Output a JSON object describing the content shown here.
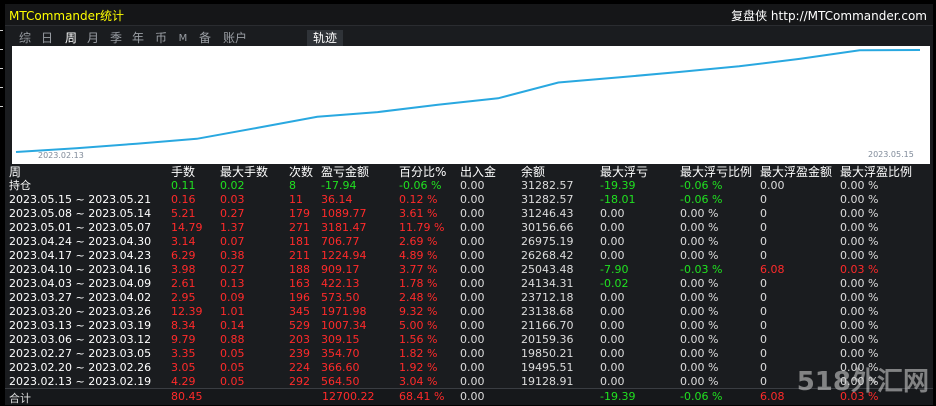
{
  "window": {
    "title": "MTCommander统计",
    "brand": "复盘侠",
    "url": "http://MTCommander.com"
  },
  "tabs": [
    {
      "label": "综"
    },
    {
      "label": "日"
    },
    {
      "label": "周",
      "active": true
    },
    {
      "label": "月"
    },
    {
      "label": "季"
    },
    {
      "label": "年"
    },
    {
      "label": "币"
    },
    {
      "label": "M"
    },
    {
      "label": "备"
    },
    {
      "label": "账户"
    },
    {
      "label": "轨迹",
      "active": true
    }
  ],
  "chart_data": {
    "type": "line",
    "x_labels": [
      "2023.02.13",
      "2023.05.15"
    ],
    "series": [
      {
        "color": "#29a8e0",
        "values": [
          0,
          4.29,
          9.34,
          14.79,
          26.94,
          39.37,
          44.59,
          52.87,
          60.12,
          77.8,
          83.45,
          89.51,
          95.86,
          104.16,
          113.71,
          114.1
        ]
      }
    ]
  },
  "table": {
    "headers": [
      "周",
      "手数",
      "最大手数",
      "次数",
      "盈亏金额",
      "百分比%",
      "出入金",
      "余额",
      "最大浮亏",
      "最大浮亏比例",
      "最大浮盈金额",
      "最大浮盈比例"
    ],
    "rows": [
      {
        "cls": "pos",
        "week": "持仓",
        "lots": "0.11",
        "maxlots": "0.02",
        "count": "8",
        "pnl": "-17.94",
        "pct": "-0.06 %",
        "io": "0.00",
        "bal": "31282.57",
        "maxdd": "-19.39",
        "maxddpct": "-0.06 %",
        "maxfp": "0.00",
        "maxfppct": "0.00 %"
      },
      {
        "cls": "red",
        "week": "2023.05.15 ~ 2023.05.21",
        "lots": "0.16",
        "maxlots": "0.03",
        "count": "11",
        "pnl": "36.14",
        "pct": "0.12 %",
        "io": "0.00",
        "bal": "31282.57",
        "maxdd": "-18.01",
        "maxddpct": "-0.06 %",
        "maxfp": "0",
        "maxfppct": "0.00 %"
      },
      {
        "cls": "red",
        "week": "2023.05.08 ~ 2023.05.14",
        "lots": "5.21",
        "maxlots": "0.27",
        "count": "179",
        "pnl": "1089.77",
        "pct": "3.61 %",
        "io": "0.00",
        "bal": "31246.43",
        "maxdd": "0.00",
        "maxddpct": "0.00 %",
        "maxfp": "0",
        "maxfppct": "0.00 %"
      },
      {
        "cls": "red",
        "week": "2023.05.01 ~ 2023.05.07",
        "lots": "14.79",
        "maxlots": "1.37",
        "count": "271",
        "pnl": "3181.47",
        "pct": "11.79 %",
        "io": "0.00",
        "bal": "30156.66",
        "maxdd": "0.00",
        "maxddpct": "0.00 %",
        "maxfp": "0",
        "maxfppct": "0.00 %"
      },
      {
        "cls": "red",
        "week": "2023.04.24 ~ 2023.04.30",
        "lots": "3.14",
        "maxlots": "0.07",
        "count": "181",
        "pnl": "706.77",
        "pct": "2.69 %",
        "io": "0.00",
        "bal": "26975.19",
        "maxdd": "0.00",
        "maxddpct": "0.00 %",
        "maxfp": "0",
        "maxfppct": "0.00 %"
      },
      {
        "cls": "red",
        "week": "2023.04.17 ~ 2023.04.23",
        "lots": "6.29",
        "maxlots": "0.38",
        "count": "211",
        "pnl": "1224.94",
        "pct": "4.89 %",
        "io": "0.00",
        "bal": "26268.42",
        "maxdd": "0.00",
        "maxddpct": "0.00 %",
        "maxfp": "0",
        "maxfppct": "0.00 %"
      },
      {
        "cls": "red",
        "week": "2023.04.10 ~ 2023.04.16",
        "lots": "3.98",
        "maxlots": "0.27",
        "count": "188",
        "pnl": "909.17",
        "pct": "3.77 %",
        "io": "0.00",
        "bal": "25043.48",
        "maxdd": "-7.90",
        "maxddpct": "-0.03 %",
        "maxfp": "6.08",
        "maxfppct": "0.03 %"
      },
      {
        "cls": "red",
        "week": "2023.04.03 ~ 2023.04.09",
        "lots": "2.61",
        "maxlots": "0.13",
        "count": "163",
        "pnl": "422.13",
        "pct": "1.78 %",
        "io": "0.00",
        "bal": "24134.31",
        "maxdd": "-0.02",
        "maxddpct": "0.00 %",
        "maxfp": "0",
        "maxfppct": "0.00 %"
      },
      {
        "cls": "red",
        "week": "2023.03.27 ~ 2023.04.02",
        "lots": "2.95",
        "maxlots": "0.09",
        "count": "196",
        "pnl": "573.50",
        "pct": "2.48 %",
        "io": "0.00",
        "bal": "23712.18",
        "maxdd": "0.00",
        "maxddpct": "0.00 %",
        "maxfp": "0",
        "maxfppct": "0.00 %"
      },
      {
        "cls": "red",
        "week": "2023.03.20 ~ 2023.03.26",
        "lots": "12.39",
        "maxlots": "1.01",
        "count": "345",
        "pnl": "1971.98",
        "pct": "9.32 %",
        "io": "0.00",
        "bal": "23138.68",
        "maxdd": "0.00",
        "maxddpct": "0.00 %",
        "maxfp": "0",
        "maxfppct": "0.00 %"
      },
      {
        "cls": "red",
        "week": "2023.03.13 ~ 2023.03.19",
        "lots": "8.34",
        "maxlots": "0.14",
        "count": "529",
        "pnl": "1007.34",
        "pct": "5.00 %",
        "io": "0.00",
        "bal": "21166.70",
        "maxdd": "0.00",
        "maxddpct": "0.00 %",
        "maxfp": "0",
        "maxfppct": "0.00 %"
      },
      {
        "cls": "red",
        "week": "2023.03.06 ~ 2023.03.12",
        "lots": "9.79",
        "maxlots": "0.88",
        "count": "203",
        "pnl": "309.15",
        "pct": "1.56 %",
        "io": "0.00",
        "bal": "20159.36",
        "maxdd": "0.00",
        "maxddpct": "0.00 %",
        "maxfp": "0",
        "maxfppct": "0.00 %"
      },
      {
        "cls": "red",
        "week": "2023.02.27 ~ 2023.03.05",
        "lots": "3.35",
        "maxlots": "0.05",
        "count": "239",
        "pnl": "354.70",
        "pct": "1.82 %",
        "io": "0.00",
        "bal": "19850.21",
        "maxdd": "0.00",
        "maxddpct": "0.00 %",
        "maxfp": "0",
        "maxfppct": "0.00 %"
      },
      {
        "cls": "red",
        "week": "2023.02.20 ~ 2023.02.26",
        "lots": "3.05",
        "maxlots": "0.05",
        "count": "224",
        "pnl": "366.60",
        "pct": "1.92 %",
        "io": "0.00",
        "bal": "19495.51",
        "maxdd": "0.00",
        "maxddpct": "0.00 %",
        "maxfp": "0",
        "maxfppct": "0.00 %"
      },
      {
        "cls": "red",
        "week": "2023.02.13 ~ 2023.02.19",
        "lots": "4.29",
        "maxlots": "0.05",
        "count": "292",
        "pnl": "564.50",
        "pct": "3.04 %",
        "io": "0.00",
        "bal": "19128.91",
        "maxdd": "0.00",
        "maxddpct": "0.00 %",
        "maxfp": "0",
        "maxfppct": "0.00 %"
      }
    ],
    "total": {
      "label": "合计",
      "lots": "80.45",
      "pnl": "12700.22",
      "pct": "68.41 %",
      "io": "0.00",
      "maxdd": "-19.39",
      "maxddpct": "-0.06 %",
      "maxfp": "6.08",
      "maxfppct": "0.03 %"
    }
  },
  "watermark": "518外汇网"
}
